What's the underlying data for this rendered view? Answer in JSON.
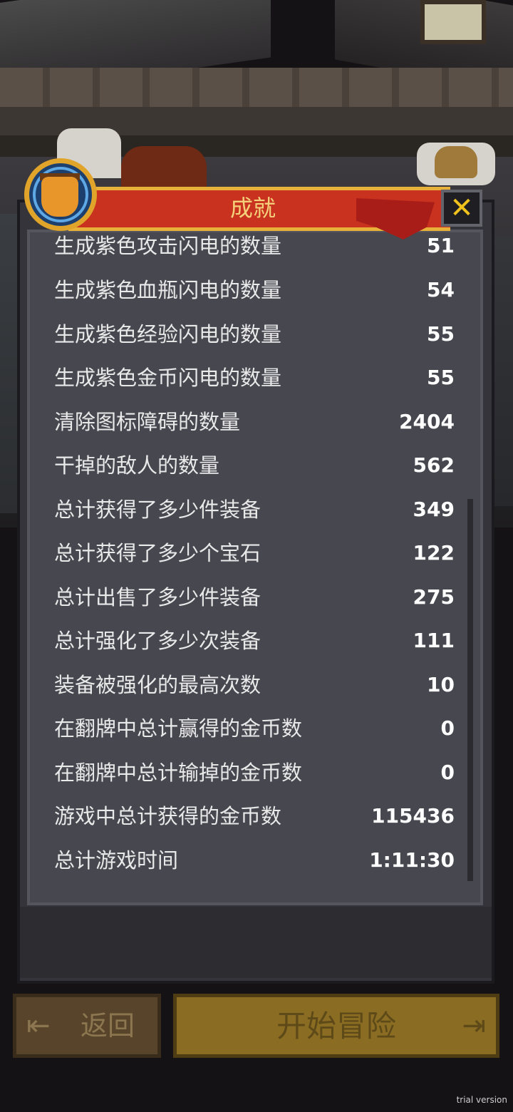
{
  "dialog": {
    "title": "成就",
    "close_glyph": "✕"
  },
  "stats": {
    "cut_row": {
      "label": "生成紫色攻击闪电的数量",
      "value": "51"
    },
    "rows": [
      {
        "label": "生成紫色血瓶闪电的数量",
        "value": "54"
      },
      {
        "label": "生成紫色经验闪电的数量",
        "value": "55"
      },
      {
        "label": "生成紫色金币闪电的数量",
        "value": "55"
      },
      {
        "label": "清除图标障碍的数量",
        "value": "2404"
      },
      {
        "label": "干掉的敌人的数量",
        "value": "562"
      },
      {
        "label": "总计获得了多少件装备",
        "value": "349"
      },
      {
        "label": "总计获得了多少个宝石",
        "value": "122"
      },
      {
        "label": "总计出售了多少件装备",
        "value": "275"
      },
      {
        "label": "总计强化了多少次装备",
        "value": "111"
      },
      {
        "label": "装备被强化的最高次数",
        "value": "10"
      },
      {
        "label": "在翻牌中总计赢得的金币数",
        "value": "0"
      },
      {
        "label": "在翻牌中总计输掉的金币数",
        "value": "0"
      },
      {
        "label": "游戏中总计获得的金币数",
        "value": "115436"
      },
      {
        "label": "总计游戏时间",
        "value": "1:11:30"
      }
    ]
  },
  "footer": {
    "back_label": "返回",
    "back_icon": "exit-left-icon",
    "start_label": "开始冒险",
    "start_icon": "exit-right-icon"
  },
  "watermark": "trial version",
  "colors": {
    "header_red": "#c8321e",
    "gold": "#e8b23a",
    "panel": "#47474f",
    "close_x": "#f2c21c"
  }
}
